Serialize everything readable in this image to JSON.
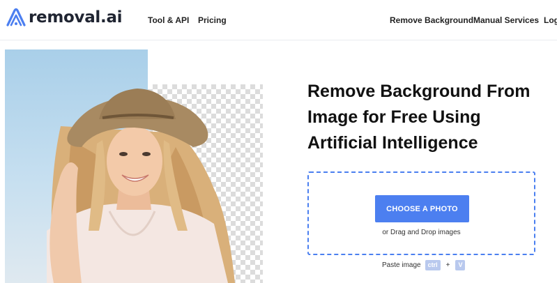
{
  "brand": {
    "name": "removal.ai",
    "accent": "#4c7ff0"
  },
  "nav": {
    "left": [
      "Tool & API",
      "Pricing"
    ],
    "right": [
      "Remove Background",
      "Manual Services",
      "Login"
    ]
  },
  "hero": {
    "headline_lines": [
      "Remove Background From",
      "Image for Free Using",
      "Artificial Intelligence"
    ]
  },
  "upload": {
    "button_label": "CHOOSE A PHOTO",
    "drag_text": "or Drag and Drop images",
    "paste_label": "Paste image",
    "key_ctrl": "ctrl",
    "key_plus": "+",
    "key_v": "V"
  },
  "icons": [
    "removal-logo-icon"
  ]
}
